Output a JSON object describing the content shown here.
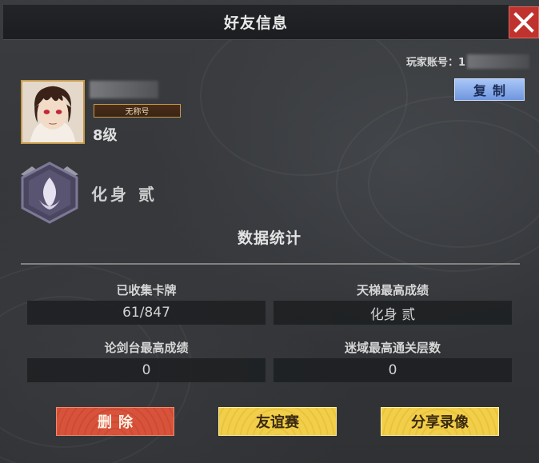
{
  "dialog": {
    "title": "好友信息",
    "close_icon": "close-x-icon"
  },
  "account": {
    "label": "玩家账号：1",
    "copy_label": "复制"
  },
  "player": {
    "title_badge": "无称号",
    "level": "8级"
  },
  "rank": {
    "name": "化身 贰",
    "emblem_icon": "flame-emblem-icon"
  },
  "stats": {
    "section_title": "数据统计",
    "items": [
      {
        "label": "已收集卡牌",
        "value": "61/847"
      },
      {
        "label": "天梯最高成绩",
        "value": "化身 贰"
      },
      {
        "label": "论剑台最高成绩",
        "value": "0"
      },
      {
        "label": "迷域最高通关层数",
        "value": "0"
      }
    ]
  },
  "actions": {
    "delete_label": "删除",
    "friendly_match_label": "友谊赛",
    "share_replay_label": "分享录像"
  },
  "colors": {
    "close_red": "#c0322d",
    "copy_blue": "#7fa4e6",
    "delete_red": "#d8533b",
    "button_yellow": "#f2cf4a",
    "avatar_border": "#c79a4a"
  }
}
